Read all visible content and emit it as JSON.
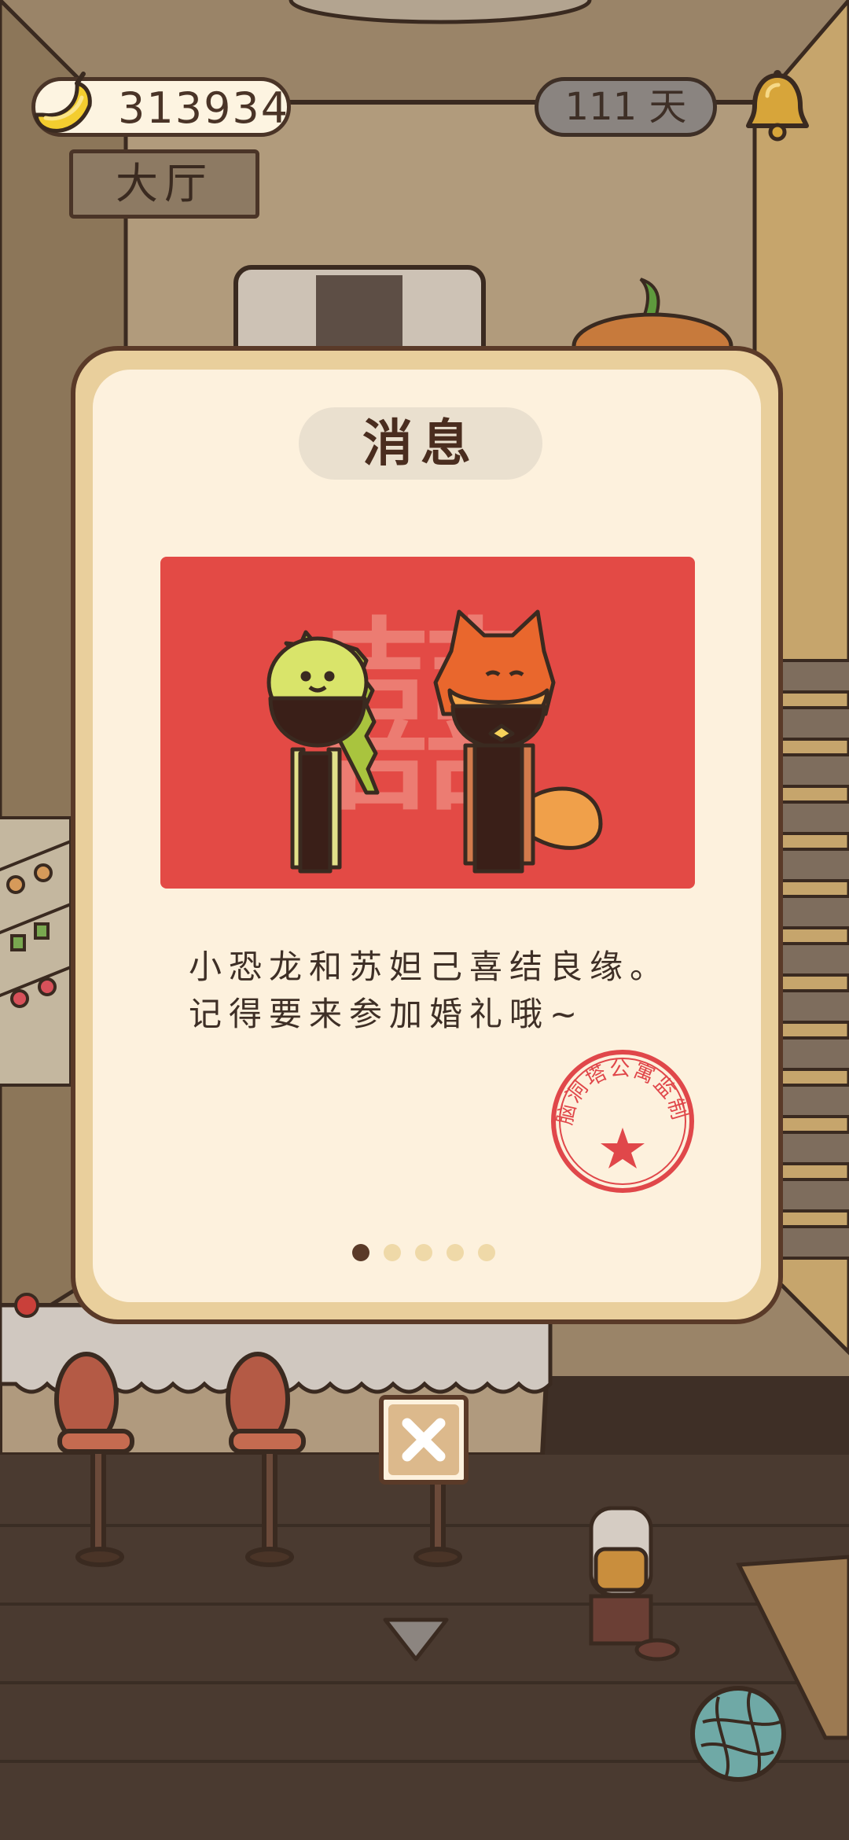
{
  "hud": {
    "coins": "313934",
    "room_name": "大厅",
    "days": "111 天"
  },
  "modal": {
    "title": "消息",
    "card_character": "囍",
    "message_line1": "小恐龙和苏妲己喜结良缘。",
    "message_line2": "记得要来参加婚礼哦~",
    "stamp_text": "脑洞塔公寓监制",
    "page_count": 5,
    "current_page": 1
  },
  "colors": {
    "card_red": "#e34a45",
    "stamp_red": "#e0474a",
    "frame_brown": "#5a3a28",
    "panel_cream": "#fdf1dd"
  },
  "icons": {
    "currency": "banana-icon",
    "notification": "bell-icon",
    "close": "close-icon",
    "scroll_down": "chevron-down-icon",
    "toy": "yarn-ball-icon"
  }
}
